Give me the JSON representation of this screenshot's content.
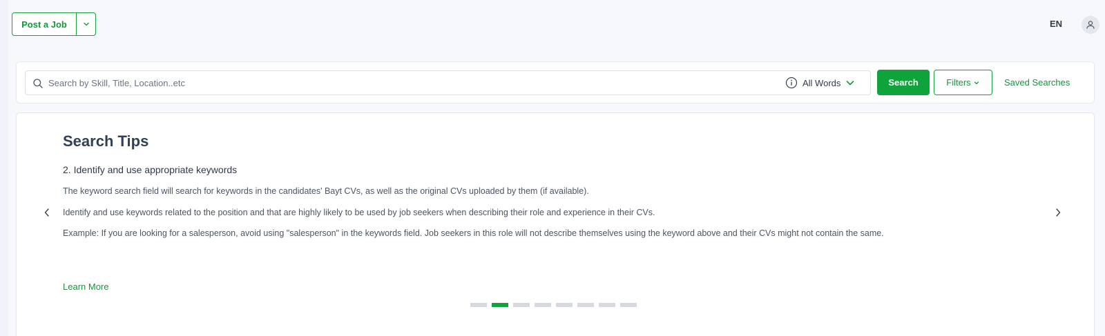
{
  "header": {
    "post_job_label": "Post a Job",
    "language": "EN"
  },
  "search": {
    "placeholder": "Search by Skill, Title, Location..etc",
    "value": "",
    "match_mode": "All Words",
    "search_label": "Search",
    "filters_label": "Filters",
    "saved_searches_label": "Saved Searches"
  },
  "tips": {
    "title": "Search Tips",
    "current_tip": {
      "heading": "2. Identify and use appropriate keywords",
      "paragraphs": [
        "The keyword search field will search for keywords in the candidates' Bayt CVs, as well as the original CVs uploaded by them (if available).",
        "Identify and use keywords related to the position and that are highly likely to be used by job seekers when describing their role and experience in their CVs.",
        "Example: If you are looking for a salesperson, avoid using \"salesperson\" in the keywords field. Job seekers in this role will not describe themselves using the keyword above and their CVs might not contain the same."
      ]
    },
    "learn_more_label": "Learn More",
    "total_slides": 8,
    "active_slide": 2
  },
  "colors": {
    "brand_green": "#0fa33b",
    "text_dark": "#2f3a4a",
    "inactive_dot": "#d6d9df"
  },
  "icons": {
    "caret": "chevron-down-icon",
    "search": "search-icon",
    "info": "info-icon",
    "user": "user-icon",
    "prev": "chevron-left-icon",
    "next": "chevron-right-icon"
  }
}
